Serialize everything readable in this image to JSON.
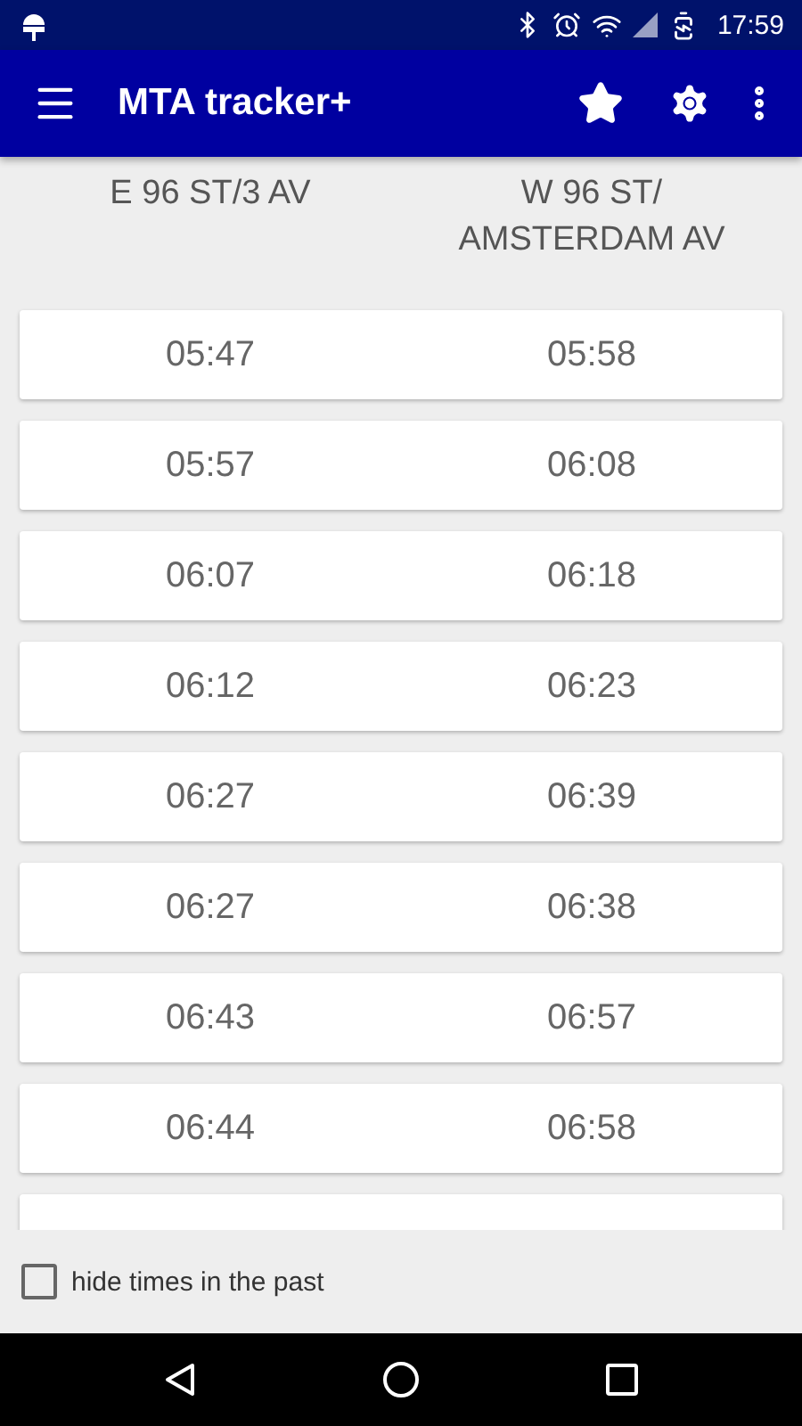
{
  "status_bar": {
    "time": "17:59"
  },
  "app_bar": {
    "title": "MTA tracker+"
  },
  "columns": [
    "E 96 ST/3 AV",
    "W 96 ST/\nAMSTERDAM AV"
  ],
  "rows": [
    {
      "times": [
        "05:47",
        "05:58"
      ]
    },
    {
      "times": [
        "05:57",
        "06:08"
      ]
    },
    {
      "times": [
        "06:07",
        "06:18"
      ]
    },
    {
      "times": [
        "06:12",
        "06:23"
      ]
    },
    {
      "times": [
        "06:27",
        "06:39"
      ]
    },
    {
      "times": [
        "06:27",
        "06:38"
      ]
    },
    {
      "times": [
        "06:43",
        "06:57"
      ]
    },
    {
      "times": [
        "06:44",
        "06:58"
      ]
    },
    {
      "times": []
    }
  ],
  "hide_past": {
    "label": "hide times in the past",
    "checked": false
  }
}
